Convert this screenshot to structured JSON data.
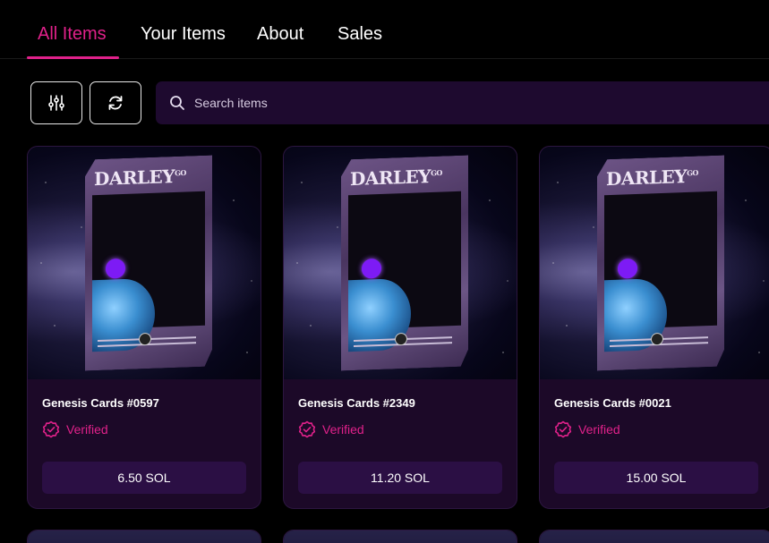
{
  "tabs": [
    {
      "label": "All Items",
      "active": true
    },
    {
      "label": "Your Items",
      "active": false
    },
    {
      "label": "About",
      "active": false
    },
    {
      "label": "Sales",
      "active": false
    }
  ],
  "toolbar": {
    "filter_icon": "sliders-icon",
    "refresh_icon": "refresh-icon",
    "search_placeholder": "Search items"
  },
  "cards": [
    {
      "name": "Genesis Cards #0597",
      "verified_label": "Verified",
      "price": "6.50 SOL"
    },
    {
      "name": "Genesis Cards #2349",
      "verified_label": "Verified",
      "price": "11.20 SOL"
    },
    {
      "name": "Genesis Cards #0021",
      "verified_label": "Verified",
      "price": "15.00 SOL"
    }
  ],
  "card_art": {
    "title": "DARLEY",
    "title_super": "GO"
  },
  "colors": {
    "accent": "#e0218a",
    "background": "#000000",
    "card_bg": "#1c0928",
    "price_bg": "#2b0f44",
    "search_bg": "#1e0a2f"
  }
}
